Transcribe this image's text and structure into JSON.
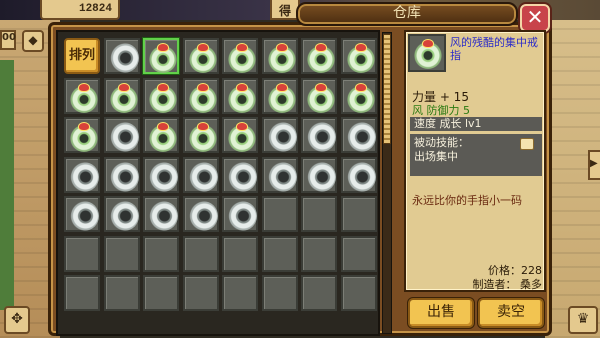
{
  "hud": {
    "gold": "12824",
    "left_tab": "得",
    "title": "仓库",
    "close": "✕",
    "left_mini": "00",
    "diamond_icon": "◆",
    "bottom_left_icon": "✥",
    "bottom_right_icon": "♛",
    "right_arrow": "▶"
  },
  "inventory": {
    "sort_label": "排列",
    "columns": 8,
    "rows": 7,
    "selected_index": 2,
    "items": [
      "sort",
      "plain",
      "green",
      "green",
      "green",
      "green",
      "green",
      "green",
      "green",
      "green",
      "green",
      "green",
      "green",
      "green",
      "green",
      "green",
      "green",
      "plain",
      "green",
      "green",
      "green",
      "plain",
      "plain",
      "plain",
      "plain",
      "plain",
      "plain",
      "plain",
      "plain",
      "plain",
      "plain",
      "plain",
      "plain",
      "plain",
      "plain",
      "plain",
      "plain",
      "empty",
      "empty",
      "empty",
      "empty",
      "empty",
      "empty",
      "empty",
      "empty",
      "empty",
      "empty",
      "empty",
      "empty",
      "empty",
      "empty",
      "empty",
      "empty",
      "empty",
      "empty",
      "empty"
    ]
  },
  "detail": {
    "name": "风的残酷的集中戒指",
    "stat_line_1": "力量 + 15",
    "stat_line_2": "风 防御力 5",
    "speed_line": "速度 成长 lv1",
    "passive_title": "被动技能：",
    "passive_value": "出场集中",
    "description": "永远比你的手指小一码",
    "price": "价格：228",
    "maker": "制造者： 桑多"
  },
  "buttons": {
    "sell": "出售",
    "sell_all": "卖空"
  }
}
